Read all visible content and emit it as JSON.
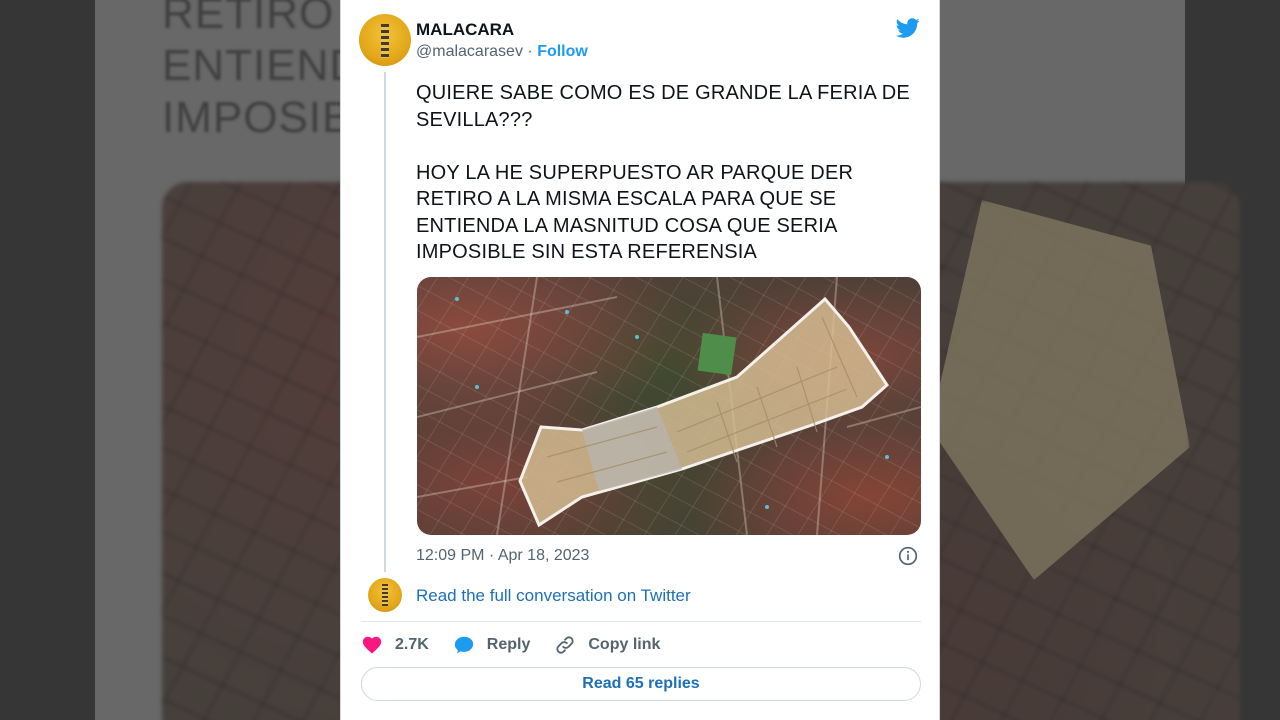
{
  "background": {
    "text": "RETIRO A                        QUE SE\nENTIEND                         SERIA\nIMPOSIBI"
  },
  "tweet": {
    "author_name": "MALACARA",
    "handle": "@malacarasev",
    "separator": "·",
    "follow_label": "Follow",
    "text": "QUIERE SABE COMO ES DE GRANDE LA FERIA DE SEVILLA???\n\nHOY LA HE SUPERPUESTO AR PARQUE DER RETIRO A LA MISMA ESCALA PARA QUE SE ENTIENDA LA MASNITUD COSA QUE SERIA IMPOSIBLE SIN ESTA REFERENSIA",
    "timestamp": "12:09 PM · Apr 18, 2023"
  },
  "conversation": {
    "read_full_label": "Read the full conversation on Twitter"
  },
  "actions": {
    "likes": "2.7K",
    "reply_label": "Reply",
    "copy_link_label": "Copy link"
  },
  "footer": {
    "read_replies_label": "Read 65 replies"
  },
  "colors": {
    "accent": "#1d9bf0",
    "link": "#1d6fb8",
    "like": "#f91880",
    "text": "#0f1419",
    "muted": "#536471"
  },
  "icons": [
    "twitter-bird-icon",
    "info-icon",
    "heart-icon",
    "reply-bubble-icon",
    "link-icon"
  ]
}
